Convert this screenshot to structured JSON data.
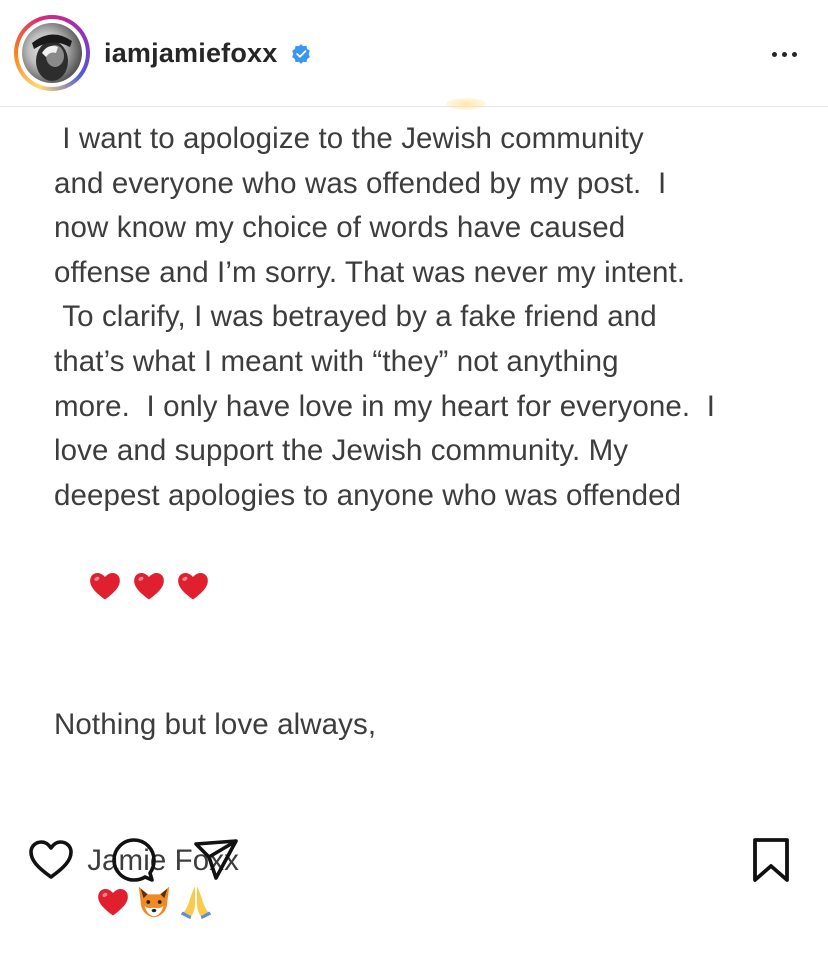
{
  "header": {
    "username": "iamjamiefoxx",
    "verified": true,
    "more_icon": "more-horizontal-icon"
  },
  "post": {
    "lines": [
      " I want to apologize to the Jewish community",
      "and everyone who was offended by my post.  I",
      "now know my choice of words have caused",
      "offense and I’m sorry. That was never my intent.",
      " To clarify, I was betrayed by a fake friend and",
      "that’s what I meant with “they” not anything",
      "more.  I only have love in my heart for everyone.  I",
      "love and support the Jewish community. My",
      "deepest apologies to anyone who was offended"
    ],
    "emoji_line": [
      "red-heart-emoji",
      "red-heart-emoji",
      "red-heart-emoji"
    ],
    "closing": "Nothing but love always,",
    "signature": "Jamie Foxx",
    "signature_emojis": [
      "red-heart-emoji",
      "fox-emoji",
      "folded-hands-emoji"
    ]
  },
  "actions": {
    "like_icon": "heart-outline-icon",
    "comment_icon": "comment-icon",
    "share_icon": "send-icon",
    "save_icon": "bookmark-icon"
  },
  "colors": {
    "text": "#3d3d3d",
    "username": "#262626",
    "verified": "#3897f0",
    "heart": "#e0202f"
  }
}
